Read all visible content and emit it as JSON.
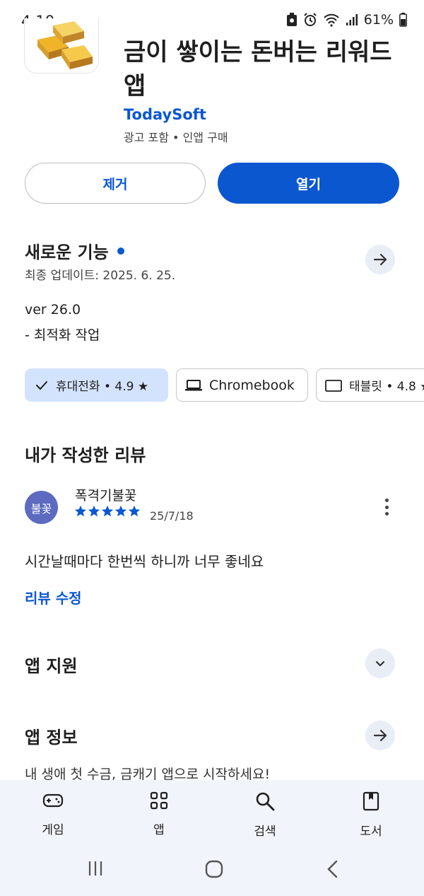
{
  "status_bar": {
    "time": "4:10",
    "battery": "61%"
  },
  "app": {
    "title": "금이 쌓이는 돈버는 리워드 앱",
    "developer": "TodaySoft",
    "meta": "광고 포함 • 인앱 구매"
  },
  "actions": {
    "uninstall_label": "제거",
    "open_label": "열기"
  },
  "whats_new": {
    "title": "새로운 기능",
    "updated": "최종 업데이트: 2025. 6. 25.",
    "version": "ver 26.0",
    "notes": "- 최적화 작업"
  },
  "device_chips": [
    {
      "label": "휴대전화 • 4.9 ★",
      "selected": true
    },
    {
      "label": "Chromebook",
      "selected": false
    },
    {
      "label": "태블릿 • 4.8 ★",
      "selected": false
    }
  ],
  "my_review": {
    "title": "내가 작성한 리뷰",
    "avatar_text": "불꽃",
    "reviewer": "폭격기불꽃",
    "rating": 5,
    "date": "25/7/18",
    "text": "시간날때마다 한번씩 하니까 너무 좋네요",
    "edit_label": "리뷰 수정"
  },
  "app_support": {
    "title": "앱 지원"
  },
  "about": {
    "title": "앱 정보",
    "snippet": "내 생애 첫 수금, 금캐기 앱으로 시작하세요!"
  },
  "bottom_nav": [
    {
      "label": "게임",
      "icon": "gamepad-icon"
    },
    {
      "label": "앱",
      "icon": "apps-grid-icon"
    },
    {
      "label": "검색",
      "icon": "search-icon"
    },
    {
      "label": "도서",
      "icon": "book-icon"
    }
  ],
  "colors": {
    "accent": "#0b57d0",
    "chip_selected": "#d3e3fd",
    "nav_background": "#f1f4fa",
    "avatar": "#5c6bc0"
  }
}
